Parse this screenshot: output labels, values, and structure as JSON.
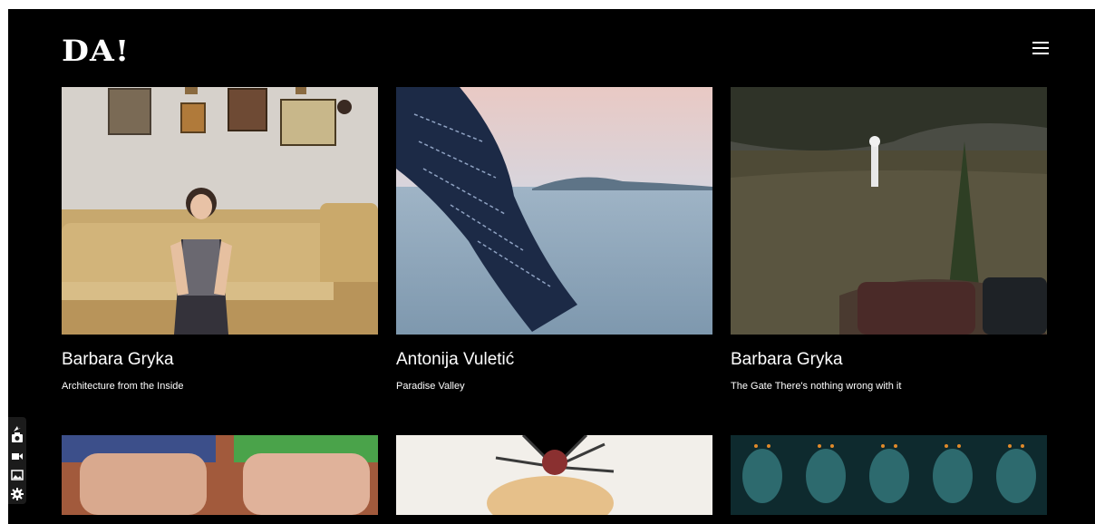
{
  "site": {
    "logo": "DA!"
  },
  "header": {
    "menu_icon": "hamburger-menu-icon"
  },
  "cards": [
    {
      "title": "Barbara Gryka",
      "subtitle": "Architecture from the Inside"
    },
    {
      "title": "Antonija Vuletić",
      "subtitle": "Paradise Valley"
    },
    {
      "title": "Barbara Gryka",
      "subtitle": "The Gate There's nothing wrong with it"
    }
  ],
  "toolbar": {
    "icons": [
      "pin-icon",
      "camera-icon",
      "video-icon",
      "gallery-icon",
      "settings-icon"
    ]
  },
  "colors": {
    "background": "#000000",
    "text": "#ffffff"
  }
}
